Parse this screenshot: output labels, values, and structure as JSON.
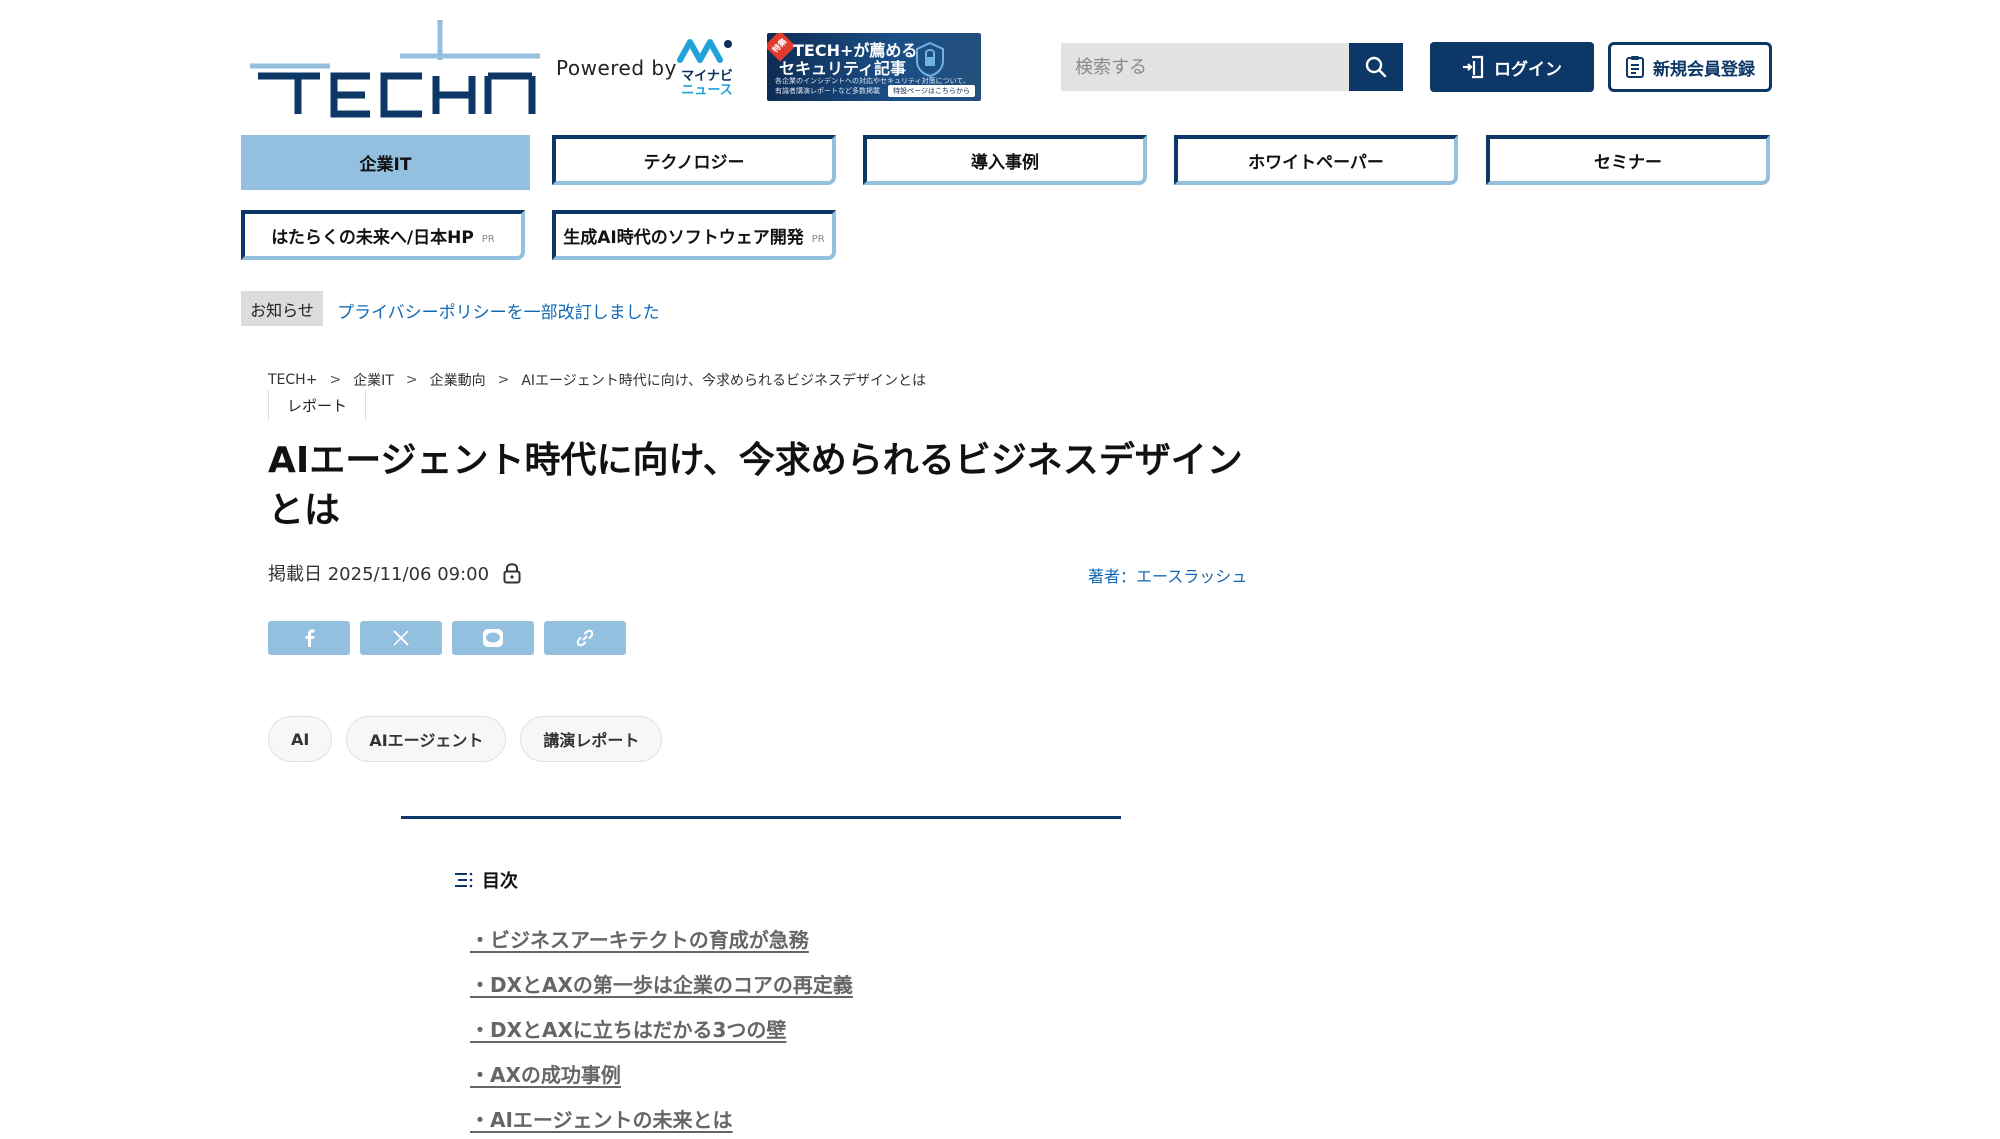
{
  "header": {
    "powered_by": "Powered by",
    "mynavi_line1": "マイナビ",
    "mynavi_line2": "ニュース",
    "banner": {
      "tag": "特集",
      "line1": "TECH+が薦める",
      "line2": "セキュリティ記事",
      "line3": "各企業のインシデントへの対応やセキュリティ対策について、",
      "line4": "有識者講演レポートなど多数掲載",
      "button": "特設ページはこちらから"
    },
    "search_placeholder": "検索する",
    "login_label": "ログイン",
    "signup_label": "新規会員登録"
  },
  "nav": {
    "row1": [
      "企業IT",
      "テクノロジー",
      "導入事例",
      "ホワイトペーパー",
      "セミナー"
    ],
    "row2": [
      "はたらくの未来へ/日本HP",
      "生成AI時代のソフトウェア開発"
    ],
    "pr_label": "PR"
  },
  "notice": {
    "badge": "お知らせ",
    "text": "プライバシーポリシーを一部改訂しました"
  },
  "breadcrumb": [
    "TECH+",
    "企業IT",
    "企業動向",
    "AIエージェント時代に向け、今求められるビジネスデザインとは"
  ],
  "breadcrumb_sep": ">",
  "article": {
    "category": "レポート",
    "title_line1": "AIエージェント時代に向け、今求められるビジネスデザイン",
    "title_line2": "とは",
    "date": "掲載日 2025/11/06 09:00",
    "author": "著者：エースラッシュ",
    "tags": [
      "AI",
      "AIエージェント",
      "講演レポート"
    ]
  },
  "toc": {
    "heading": "目次",
    "items": [
      "・ビジネスアーキテクトの育成が急務",
      "・DXとAXの第一歩は企業のコアの再定義",
      "・DXとAXに立ちはだかる3つの壁",
      "・AXの成功事例",
      "・AIエージェントの未来とは"
    ]
  },
  "colors": {
    "navy": "#0d3766",
    "light_blue": "#94c0e0",
    "link_blue": "#1169b5"
  },
  "icons": [
    "tech-plus-logo",
    "search-icon",
    "login-icon",
    "signup-icon",
    "lock-icon",
    "facebook-icon",
    "x-icon",
    "line-icon",
    "link-icon",
    "toc-list-icon"
  ]
}
